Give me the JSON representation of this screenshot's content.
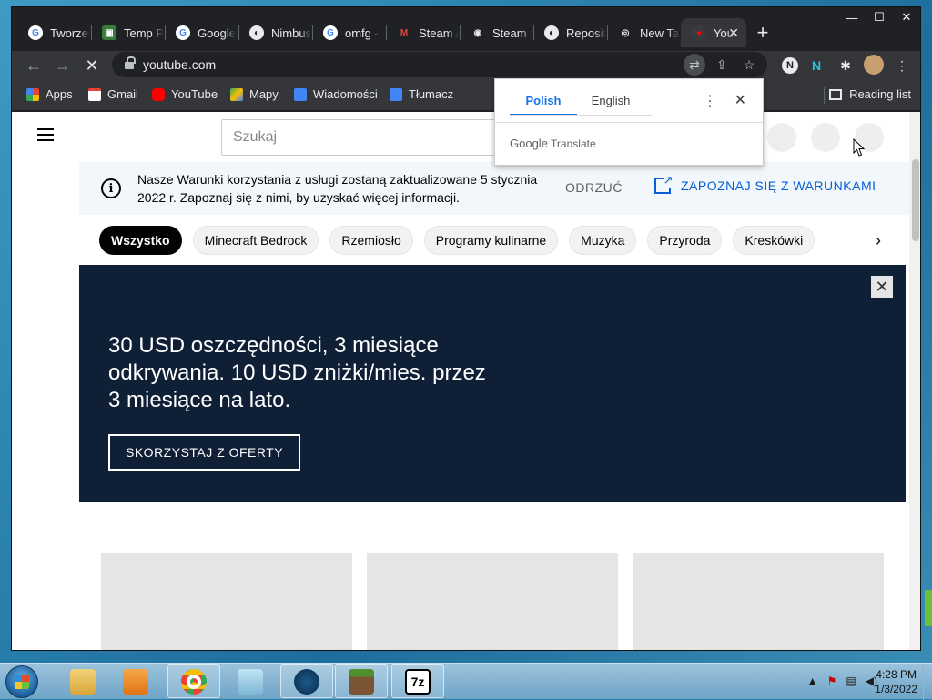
{
  "window": {
    "controls": [
      "—",
      "☐",
      "✕"
    ]
  },
  "tabs": [
    {
      "title": "Tworzenie",
      "color": "#ffffff",
      "glyph": "G"
    },
    {
      "title": "Temp Play",
      "color": "#3a7d3a",
      "glyph": "▣"
    },
    {
      "title": "Google",
      "color": "#ffffff",
      "glyph": "G"
    },
    {
      "title": "Nimbus",
      "color": "#e8eaed",
      "glyph": "◐"
    },
    {
      "title": "omfg -",
      "color": "#ffffff",
      "glyph": "G"
    },
    {
      "title": "Steam A",
      "color": "#ea4335",
      "glyph": "M"
    },
    {
      "title": "Steam S",
      "color": "#e8eaed",
      "glyph": "◉"
    },
    {
      "title": "Reposit",
      "color": "#e8eaed",
      "glyph": "◐"
    },
    {
      "title": "New Tab",
      "color": "#e8eaed",
      "glyph": "◎"
    },
    {
      "title": "You",
      "color": "#ff0000",
      "glyph": "●",
      "active": true
    }
  ],
  "new_tab_label": "+",
  "tab_close": "✕",
  "toolbar": {
    "back": "←",
    "forward": "→",
    "reload": "✕",
    "url": "youtube.com",
    "omni_icons": [
      "translate-icon",
      "share-icon",
      "star-icon"
    ],
    "extensions": [
      "N",
      "N",
      "puzzle",
      "avatar",
      "menu"
    ]
  },
  "bookmarks": [
    {
      "label": "Apps",
      "color": "#ea4335"
    },
    {
      "label": "Gmail",
      "color": "#ea4335"
    },
    {
      "label": "YouTube",
      "color": "#ff0000"
    },
    {
      "label": "Mapy",
      "color": "#34a853"
    },
    {
      "label": "Wiadomości",
      "color": "#4285f4"
    },
    {
      "label": "Tłumacz",
      "color": "#4285f4"
    }
  ],
  "reading_list": "Reading list",
  "youtube": {
    "search_placeholder": "Szukaj",
    "notice": {
      "message": "Nasze Warunki korzystania z usługi zostaną zaktualizowane 5 stycznia 2022 r. Zapoznaj się z nimi, by uzyskać więcej informacji.",
      "dismiss": "ODRZUĆ",
      "learn_more": "ZAPOZNAJ SIĘ Z WARUNKAMI"
    },
    "chips": [
      "Wszystko",
      "Minecraft Bedrock",
      "Rzemiosło",
      "Programy kulinarne",
      "Muzyka",
      "Przyroda",
      "Kreskówki"
    ],
    "promo": {
      "headline": "30 USD oszczędności, 3 miesiące odkrywania. 10 USD zniżki/mies. przez 3 miesiące na lato.",
      "cta": "SKORZYSTAJ Z OFERTY",
      "close": "✕"
    }
  },
  "translate_popup": {
    "tabs": [
      "Polish",
      "English"
    ],
    "selected": "Polish",
    "brand_google": "Google",
    "brand_translate": "Translate",
    "more": "⋮",
    "close": "✕"
  },
  "taskbar": {
    "time": "4:28 PM",
    "date": "1/3/2022",
    "seven_zip": "7z"
  }
}
